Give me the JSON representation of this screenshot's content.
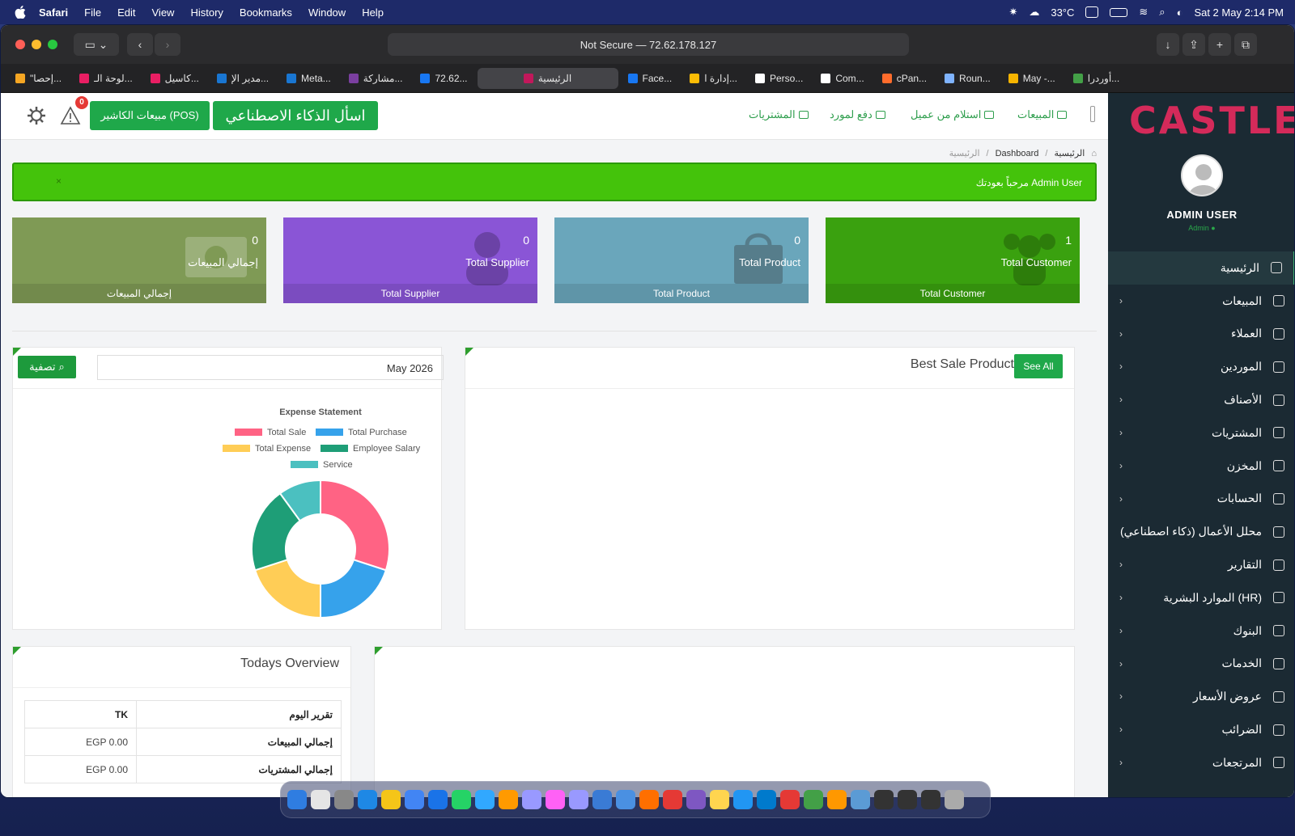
{
  "menubar": {
    "app_name": "Safari",
    "items": [
      "File",
      "Edit",
      "View",
      "History",
      "Bookmarks",
      "Window",
      "Help"
    ],
    "weather": "33°C",
    "datetime": "Sat 2 May  2:14 PM"
  },
  "browser": {
    "url": "Not Secure — 72.62.178.127",
    "tabs": [
      {
        "label": "\"إحصا...",
        "color": "#f5a623"
      },
      {
        "label": "لوحة الـ...",
        "color": "#e91e63"
      },
      {
        "label": "كاسيل...",
        "color": "#e91e63"
      },
      {
        "label": "مدير الإ...",
        "color": "#1976d2"
      },
      {
        "label": "Meta...",
        "color": "#1976d2"
      },
      {
        "label": "مشاركة...",
        "color": "#7b3fa0"
      },
      {
        "label": "72.62...",
        "color": "#1877f2"
      },
      {
        "label": "الرئيسية",
        "color": "#c2185b",
        "active": true
      },
      {
        "label": "Face...",
        "color": "#1877f2"
      },
      {
        "label": "إدارة ا...",
        "color": "#fbbc05"
      },
      {
        "label": "Perso...",
        "color": "#ffffff"
      },
      {
        "label": "Com...",
        "color": "#ffffff"
      },
      {
        "label": "cPan...",
        "color": "#ff6c2c"
      },
      {
        "label": "Roun...",
        "color": "#7fb3ff"
      },
      {
        "label": "May -...",
        "color": "#f6b400"
      },
      {
        "label": "أوردرا...",
        "color": "#43a047"
      }
    ]
  },
  "sidebar": {
    "logo": "CASTLE",
    "user_name": "ADMIN USER",
    "user_role": "Admin",
    "items": [
      {
        "label": "الرئيسية",
        "icon": "dashboard-icon",
        "active": true,
        "chevron": false
      },
      {
        "label": "المبيعات",
        "icon": "scale-icon",
        "chevron": true
      },
      {
        "label": "العملاء",
        "icon": "users-icon",
        "chevron": true
      },
      {
        "label": "الموردين",
        "icon": "lock-icon",
        "chevron": true
      },
      {
        "label": "الأصناف",
        "icon": "cubes-icon",
        "chevron": true
      },
      {
        "label": "المشتريات",
        "icon": "cart-icon",
        "chevron": true
      },
      {
        "label": "المخزن",
        "icon": "bar-chart-icon",
        "chevron": true
      },
      {
        "label": "الحسابات",
        "icon": "money-icon",
        "chevron": true
      },
      {
        "label": "محلل الأعمال (ذكاء اصطناعي)",
        "icon": "book-icon",
        "chevron": false
      },
      {
        "label": "التقارير",
        "icon": "open-book-icon",
        "chevron": true
      },
      {
        "label": "الموارد البشرية (HR)",
        "icon": "team-icon",
        "chevron": true
      },
      {
        "label": "البنوك",
        "icon": "bank-icon",
        "chevron": true
      },
      {
        "label": "الخدمات",
        "icon": "service-icon",
        "chevron": true
      },
      {
        "label": "عروض الأسعار",
        "icon": "quote-icon",
        "chevron": true
      },
      {
        "label": "الضرائب",
        "icon": "tax-icon",
        "chevron": true
      },
      {
        "label": "المرتجعات",
        "icon": "return-icon",
        "chevron": true
      }
    ]
  },
  "topnav": {
    "notification_count": "0",
    "pos_button": "مبيعات الكاشير (POS)",
    "ai_button": "اسأل الذكاء الاصطناعي",
    "links": {
      "purchases": "المشتريات",
      "pay_supplier": "دفع لمورد",
      "receive_customer": "استلام من عميل",
      "sales": "المبيعات"
    }
  },
  "breadcrumb": {
    "home": "الرئيسية",
    "dashboard": "Dashboard",
    "current": "الرئيسية"
  },
  "welcome": {
    "text": "مرحباً بعودتك Admin User",
    "close": "×"
  },
  "cards": [
    {
      "value": "0",
      "title": "إجمالي المبيعات",
      "footer": "إجمالي المبيعات",
      "color": "#7f9a55",
      "icon": "money-icon"
    },
    {
      "value": "0",
      "title": "Total Supplier",
      "footer": "Total Supplier",
      "color": "#8a55d6",
      "icon": "user-icon"
    },
    {
      "value": "0",
      "title": "Total Product",
      "footer": "Total Product",
      "color": "#6aa6bb",
      "icon": "bag-icon"
    },
    {
      "value": "1",
      "title": "Total Customer",
      "footer": "Total Customer",
      "color": "#3aa10f",
      "icon": "group-icon"
    }
  ],
  "expense_panel": {
    "filter_label": "تصفية",
    "month_value": "May 2026"
  },
  "chart_data": {
    "type": "pie",
    "title": "Expense Statement",
    "legend_position": "top",
    "series": [
      {
        "name": "Total Sale",
        "value": 30,
        "color": "#ff6384"
      },
      {
        "name": "Total Purchase",
        "value": 20,
        "color": "#36a2eb"
      },
      {
        "name": "Total Expense",
        "value": 20,
        "color": "#ffcd56"
      },
      {
        "name": "Employee Salary",
        "value": 20,
        "color": "#1e9e77"
      },
      {
        "name": "Service",
        "value": 10,
        "color": "#4bc0c0"
      }
    ]
  },
  "best_sale": {
    "title": "Best Sale Product",
    "see_all": "See All"
  },
  "overview": {
    "title": "Todays Overview",
    "header": [
      "تقرير اليوم",
      "TK"
    ],
    "rows": [
      {
        "label": "إجمالي المبيعات",
        "value": "EGP 0.00"
      },
      {
        "label": "إجمالي المشتريات",
        "value": "EGP 0.00"
      }
    ]
  }
}
